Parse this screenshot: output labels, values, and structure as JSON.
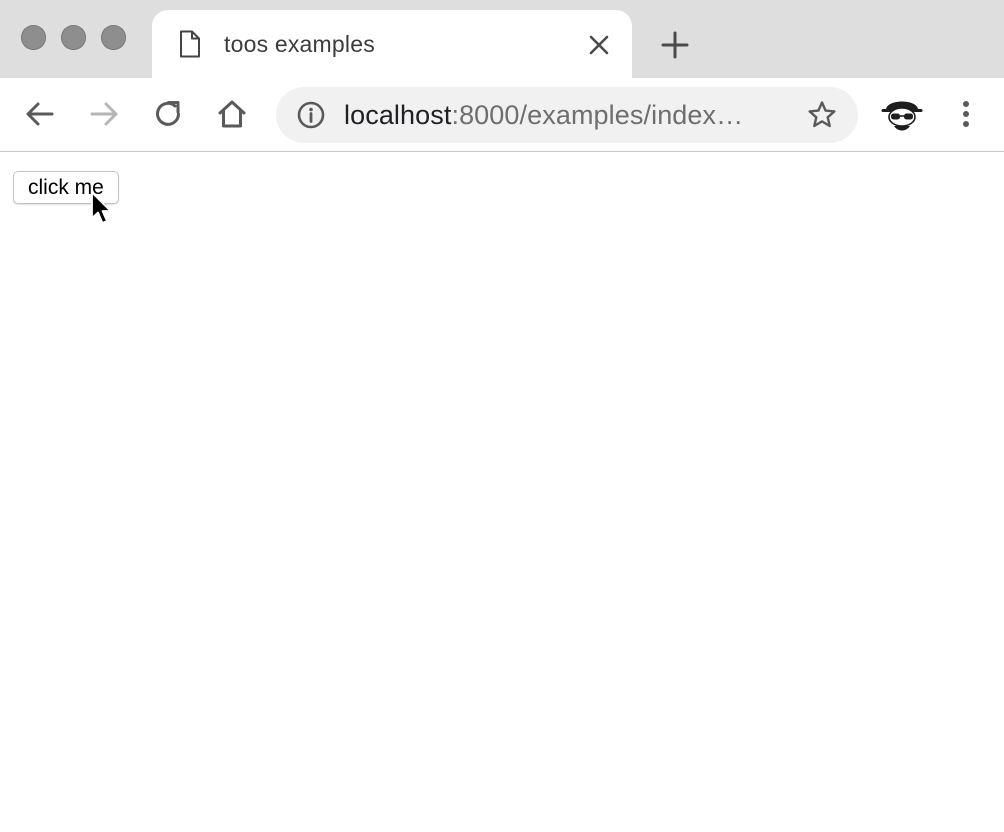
{
  "browser": {
    "tab": {
      "title": "toos examples",
      "favicon_icon": "page-icon",
      "close_icon": "close-icon"
    },
    "new_tab_icon": "plus-icon",
    "toolbar": {
      "back_icon": "arrow-left-icon",
      "forward_icon": "arrow-right-icon",
      "reload_icon": "reload-icon",
      "home_icon": "home-icon",
      "info_icon": "info-icon",
      "bookmark_icon": "star-icon",
      "profile_icon": "incognito-avatar-icon",
      "menu_icon": "vertical-dots-icon"
    },
    "address": {
      "host": "localhost",
      "rest": ":8000/examples/index…"
    }
  },
  "page": {
    "button_label": "click me"
  },
  "colors": {
    "tabstrip_bg": "#dedede",
    "omnibox_bg": "#f1f1f1",
    "traffic_light": "#8e8e8e"
  }
}
